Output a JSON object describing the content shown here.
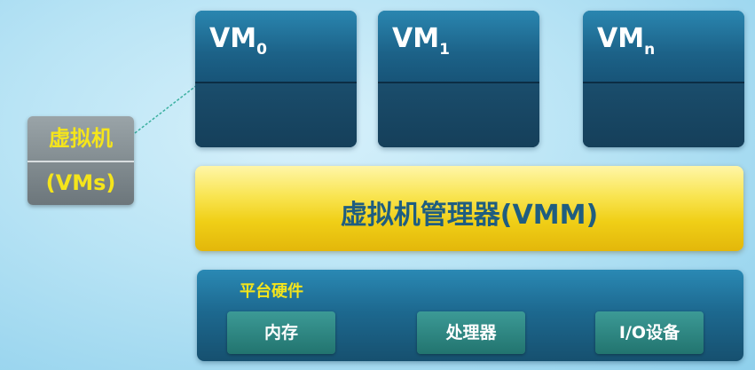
{
  "vms": [
    {
      "name": "VM",
      "sub": "0"
    },
    {
      "name": "VM",
      "sub": "1"
    },
    {
      "name": "VM",
      "sub": "n"
    }
  ],
  "legend": {
    "line1": "虚拟机",
    "line2": "(VMs)"
  },
  "vmm": {
    "label": "虚拟机管理器(VMM)"
  },
  "hardware": {
    "title": "平台硬件",
    "items": [
      "内存",
      "处理器",
      "I/O设备"
    ]
  },
  "colors": {
    "vm_box": "#1c6288",
    "vmm_bar": "#f0cf17",
    "vmm_text": "#1f5d80",
    "hw_item": "#22746f",
    "accent_yellow": "#f5e51b"
  }
}
